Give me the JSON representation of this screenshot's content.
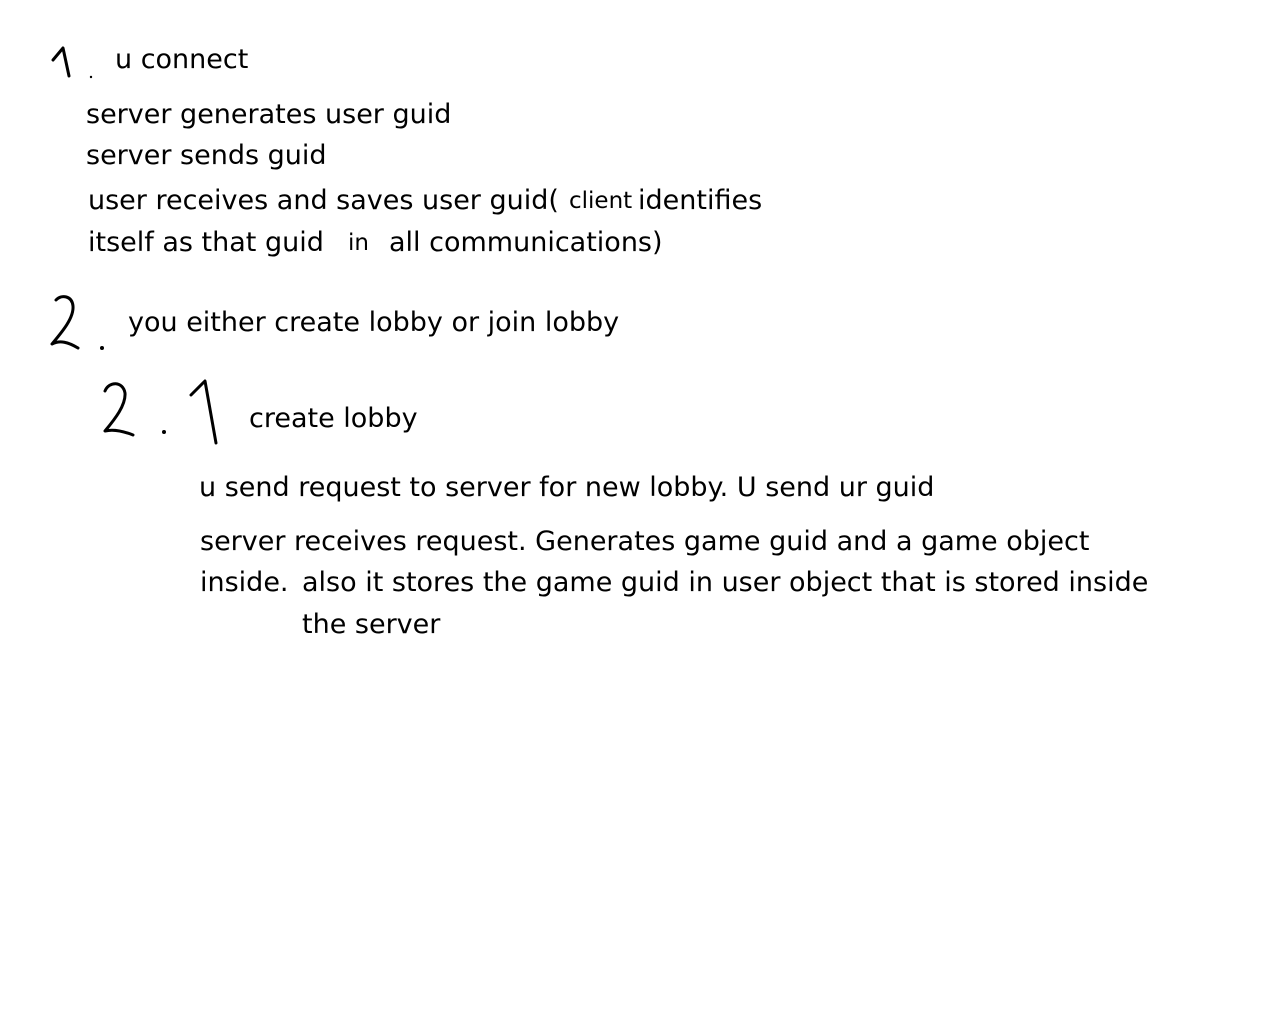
{
  "numbers": {
    "step1": "1.",
    "step2": "2.",
    "step2_1": "2.1"
  },
  "section1": {
    "title": "u connect",
    "line1": "server generates user guid",
    "line2": "server sends guid",
    "line3a": "user receives and saves user guid(",
    "line3b": "client",
    "line3c": "identifies",
    "line4a": "itself as that guid",
    "line4b": "in",
    "line4c": "all communications)"
  },
  "section2": {
    "title": "you either create lobby or join lobby"
  },
  "section2_1": {
    "title": "create lobby",
    "line1": "u send request to server for new lobby. U send ur guid",
    "line2": "server receives request. Generates game guid and a game object",
    "line3a": "inside.",
    "line3b": "also it stores the game guid in user object that is stored inside",
    "line4": "the server"
  }
}
